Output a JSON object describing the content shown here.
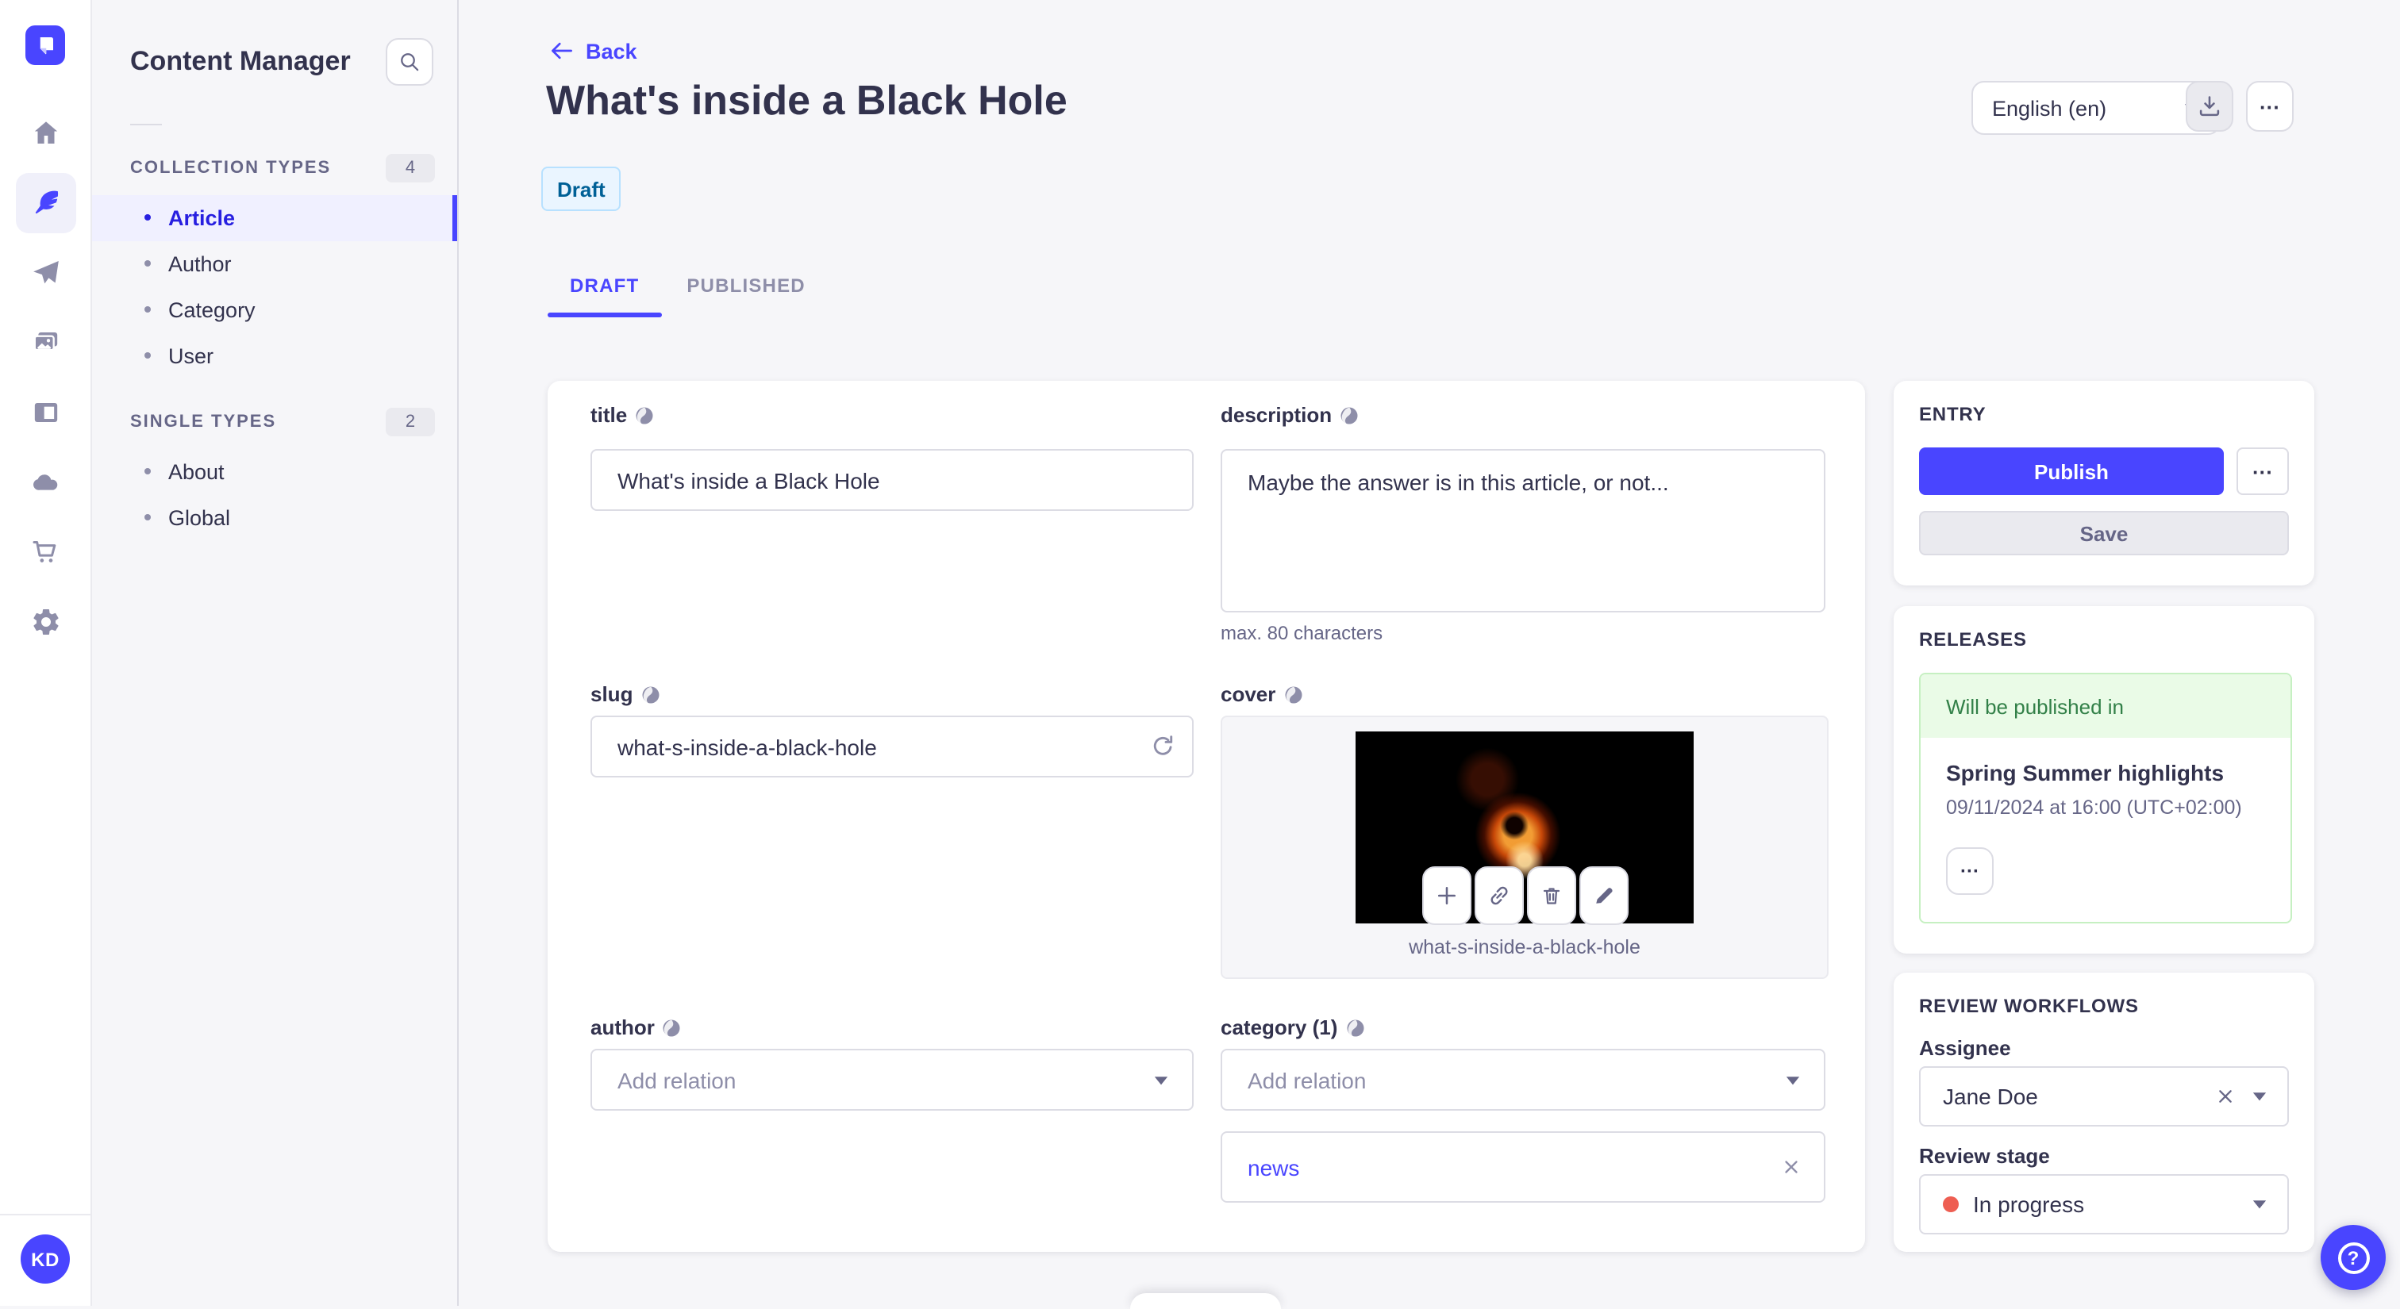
{
  "colors": {
    "primary": "#4945ff",
    "primary_dark": "#271fe0",
    "primary_light": "#f0f0ff",
    "draft_bg": "#eaf5ff",
    "draft_border": "#b8e1ff",
    "draft_text": "#006096",
    "success_bg": "#eafbe7",
    "success_border": "#c6f0c2",
    "success_text": "#328048",
    "danger": "#ee5e52",
    "text": "#32324d",
    "text_muted": "#666687"
  },
  "rail": {
    "logo_icon": "strapi-logo",
    "icons": [
      "home-icon",
      "feather-icon",
      "paper-plane-icon",
      "pictures-icon",
      "layout-icon",
      "cloud-icon",
      "cart-icon",
      "gear-icon"
    ],
    "avatar_initials": "KD"
  },
  "sidebar": {
    "title": "Content Manager",
    "search_icon": "search-icon",
    "sections": [
      {
        "label": "COLLECTION TYPES",
        "count": "4",
        "items": [
          {
            "label": "Article"
          },
          {
            "label": "Author"
          },
          {
            "label": "Category"
          },
          {
            "label": "User"
          }
        ]
      },
      {
        "label": "SINGLE TYPES",
        "count": "2",
        "items": [
          {
            "label": "About"
          },
          {
            "label": "Global"
          }
        ]
      }
    ]
  },
  "header": {
    "back_label": "Back",
    "title": "What's inside a Black Hole",
    "status_badge": "Draft",
    "locale_value": "English (en)",
    "more_label": "···",
    "tabs": [
      {
        "label": "DRAFT"
      },
      {
        "label": "PUBLISHED"
      }
    ]
  },
  "form": {
    "title_field": {
      "label": "title",
      "value": "What's inside a Black Hole"
    },
    "description_field": {
      "label": "description",
      "value": "Maybe the answer is in this article, or not...",
      "hint": "max. 80 characters"
    },
    "slug_field": {
      "label": "slug",
      "value": "what-s-inside-a-black-hole"
    },
    "cover_field": {
      "label": "cover",
      "caption": "what-s-inside-a-black-hole",
      "tool_icons": [
        "plus-icon",
        "link-icon",
        "trash-icon",
        "pencil-icon"
      ]
    },
    "author_field": {
      "label": "author",
      "placeholder": "Add relation"
    },
    "category_field": {
      "label": "category (1)",
      "placeholder": "Add relation",
      "relations": [
        {
          "label": "news"
        }
      ]
    }
  },
  "entry": {
    "title": "ENTRY",
    "publish_label": "Publish",
    "save_label": "Save",
    "more_label": "···"
  },
  "releases": {
    "title": "RELEASES",
    "banner": "Will be published in",
    "name": "Spring Summer highlights",
    "scheduled": "09/11/2024 at 16:00 (UTC+02:00)",
    "more_label": "···"
  },
  "review": {
    "title": "REVIEW WORKFLOWS",
    "assignee_label": "Assignee",
    "assignee_value": "Jane Doe",
    "stage_label": "Review stage",
    "stage_value": "In progress"
  },
  "help": {
    "label": "?"
  }
}
